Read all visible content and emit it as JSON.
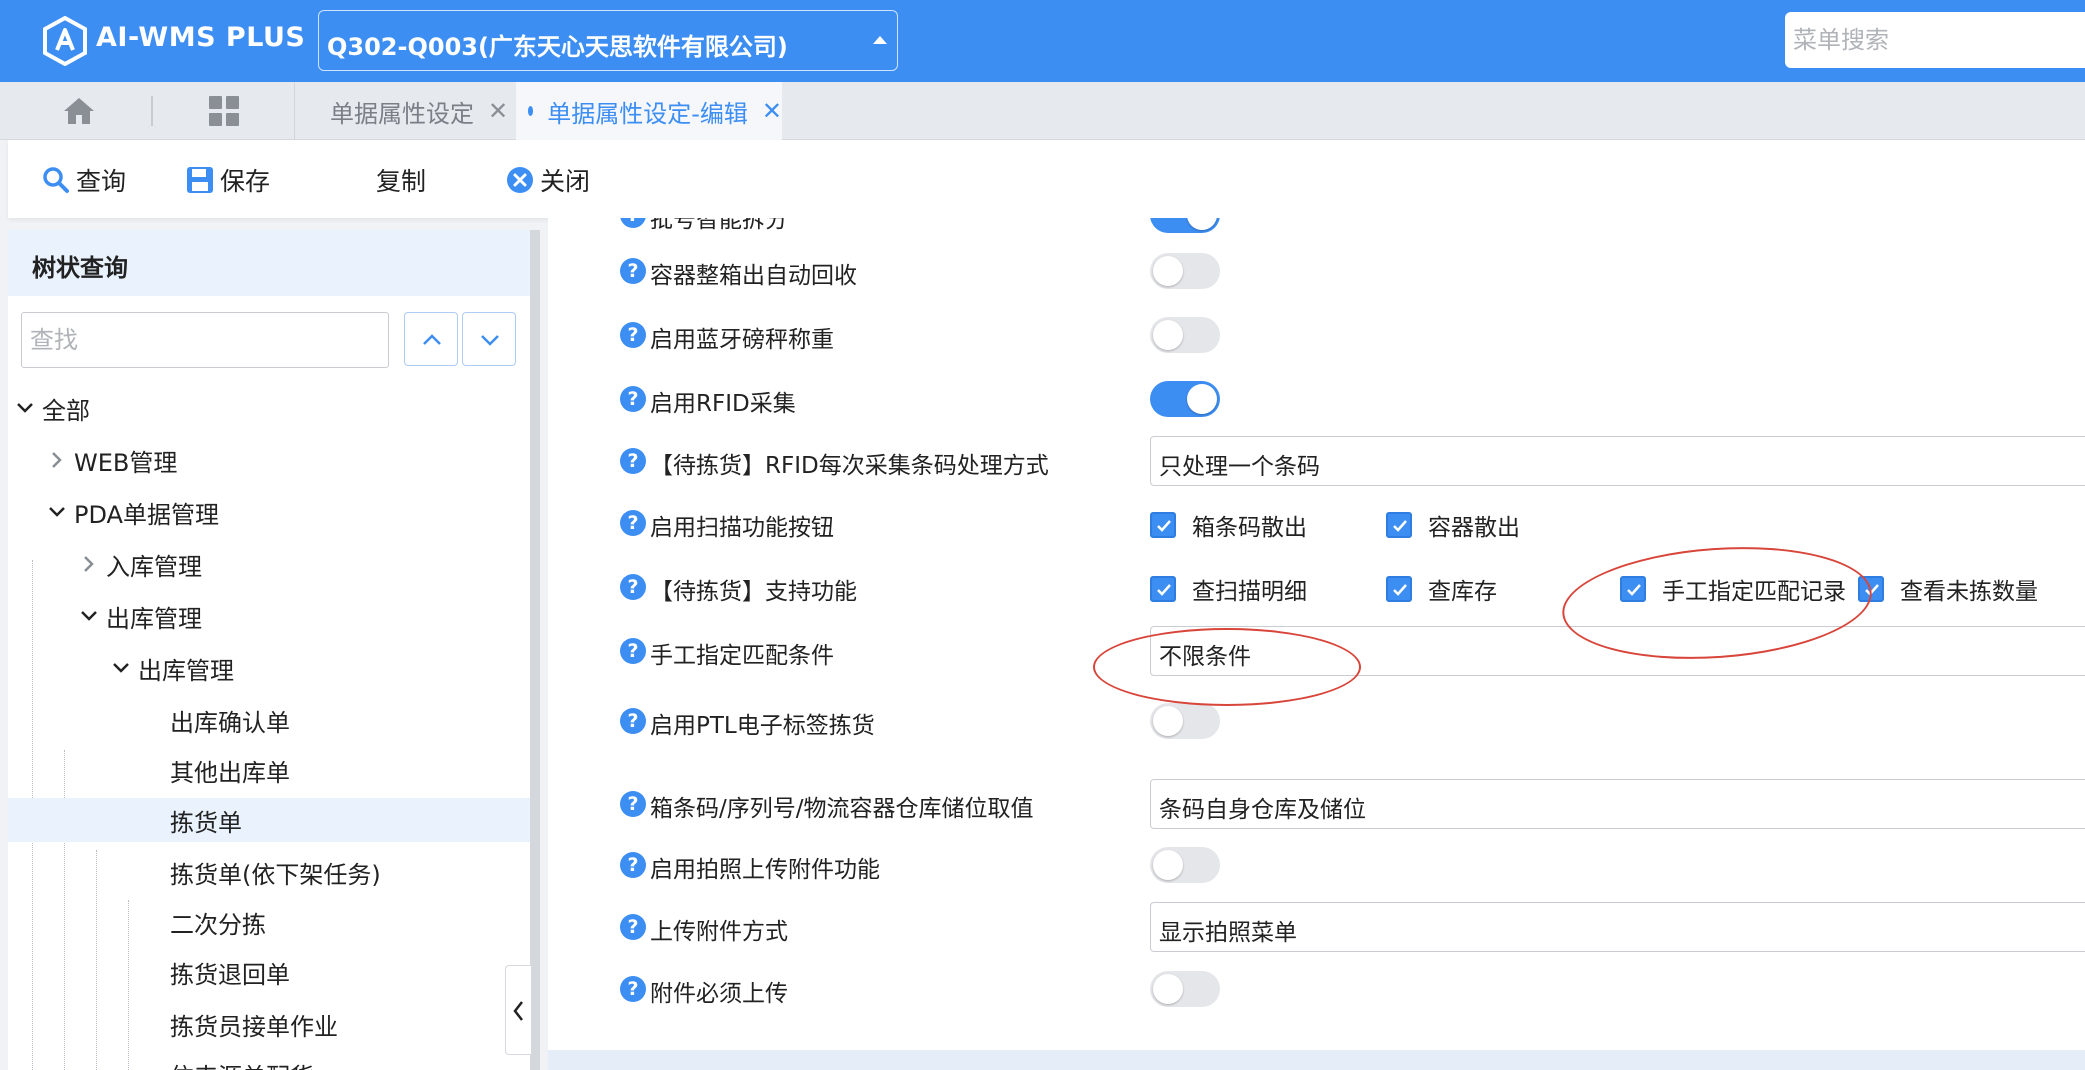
{
  "header": {
    "app_title": "AI-WMS PLUS",
    "company": "Q302-Q003(广东天心天思软件有限公司)",
    "menu_search_placeholder": "菜单搜索"
  },
  "tabs": [
    {
      "label": "单据属性设定",
      "active": false
    },
    {
      "label": "单据属性设定-编辑",
      "active": true
    }
  ],
  "toolbar": {
    "query": "查询",
    "save": "保存",
    "copy": "复制",
    "close": "关闭"
  },
  "tree": {
    "title": "树状查询",
    "search_placeholder": "查找",
    "nodes": {
      "all": "全部",
      "web": "WEB管理",
      "pda": "PDA单据管理",
      "inbound": "入库管理",
      "outbound": "出库管理",
      "outbound_sub": "出库管理",
      "confirm": "出库确认单",
      "other_out": "其他出库单",
      "picking": "拣货单",
      "picking_task": "拣货单(依下架任务)",
      "secondary_sort": "二次分拣",
      "picking_return": "拣货退回单",
      "picker_accept": "拣货员接单作业",
      "partial": "依来源单配货"
    },
    "selected": "拣货单"
  },
  "form": {
    "rows": {
      "r0": {
        "label": "批号智能拆分",
        "value": true
      },
      "r1": {
        "label": "容器整箱出自动回收",
        "value": false
      },
      "r2": {
        "label": "启用蓝牙磅秤称重",
        "value": false
      },
      "r3": {
        "label": "启用RFID采集",
        "value": true
      },
      "r4": {
        "label": "【待拣货】RFID每次采集条码处理方式",
        "value": "只处理一个条码"
      },
      "r5": {
        "label": "启用扫描功能按钮",
        "options": [
          "箱条码散出",
          "容器散出"
        ]
      },
      "r6": {
        "label": "【待拣货】支持功能",
        "options": [
          "查扫描明细",
          "查库存",
          "手工指定匹配记录",
          "查看未拣数量"
        ]
      },
      "r7": {
        "label": "手工指定匹配条件",
        "value": "不限条件"
      },
      "r8": {
        "label": "启用PTL电子标签拣货",
        "value": false
      },
      "r9": {
        "label": "箱条码/序列号/物流容器仓库储位取值",
        "value": "条码自身仓库及储位"
      },
      "r10": {
        "label": "启用拍照上传附件功能",
        "value": false
      },
      "r11": {
        "label": "上传附件方式",
        "value": "显示拍照菜单"
      },
      "r12": {
        "label": "附件必须上传",
        "value": false
      }
    }
  },
  "colors": {
    "primary": "#3d8ef3",
    "annotation": "#d8453a"
  }
}
